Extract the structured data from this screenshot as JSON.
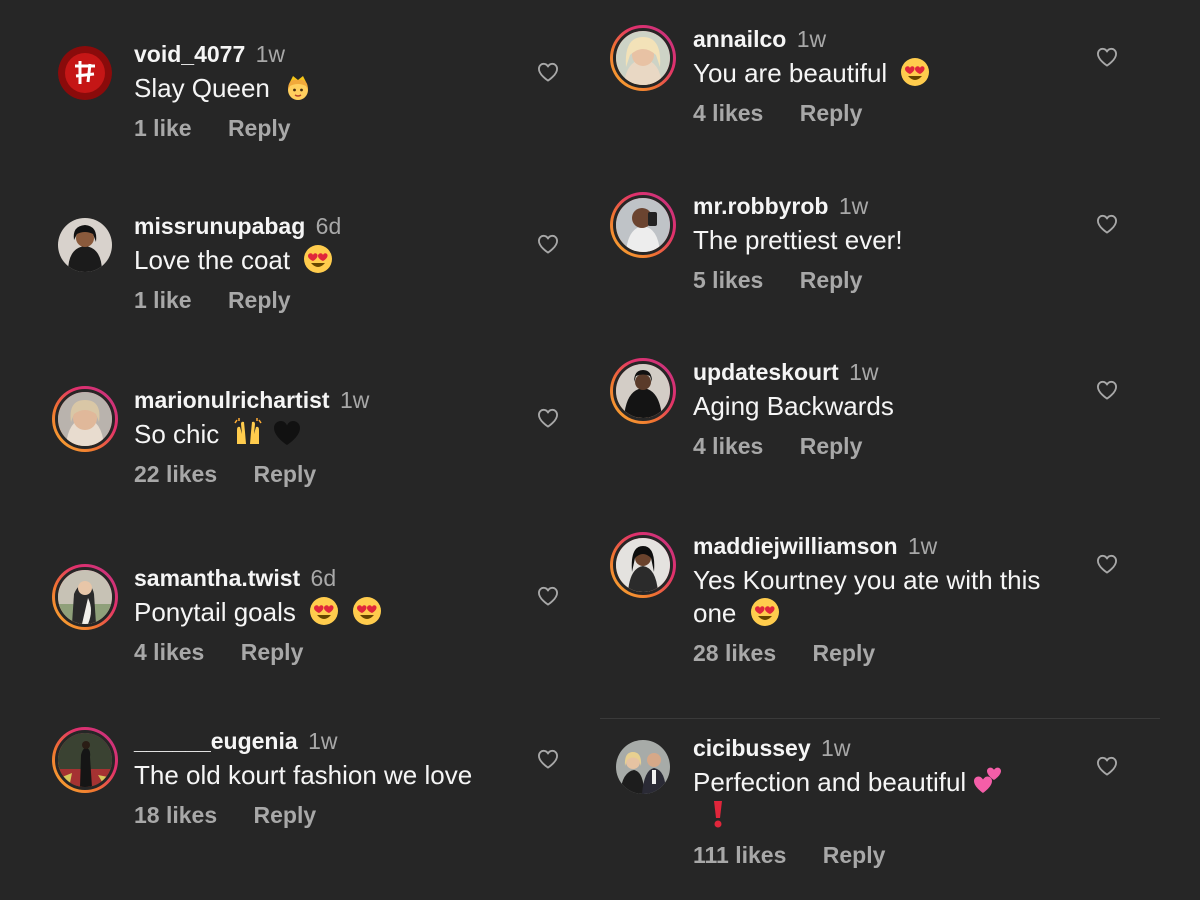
{
  "colors": {
    "background": "#262626",
    "text_primary": "#f5f5f5",
    "text_secondary": "#a8a8a8",
    "story_ring_gradient": [
      "#f9b233",
      "#e1306c",
      "#c13584"
    ]
  },
  "left_comments": [
    {
      "username": "void_4077",
      "time": "1w",
      "text": "Slay Queen",
      "emoji": [
        "princess-emoji"
      ],
      "likes": "1 like",
      "reply": "Reply",
      "story_ring": false
    },
    {
      "username": "missrunupabag",
      "time": "6d",
      "text": "Love the coat",
      "emoji": [
        "heart-eyes-emoji"
      ],
      "likes": "1 like",
      "reply": "Reply",
      "story_ring": false
    },
    {
      "username": "marionulrichartist",
      "time": "1w",
      "text": "So chic",
      "emoji": [
        "raising-hands-emoji",
        "black-heart-emoji"
      ],
      "likes": "22 likes",
      "reply": "Reply",
      "story_ring": true
    },
    {
      "username": "samantha.twist",
      "time": "6d",
      "text": "Ponytail goals",
      "emoji": [
        "heart-eyes-emoji",
        "heart-eyes-emoji"
      ],
      "likes": "4 likes",
      "reply": "Reply",
      "story_ring": true
    },
    {
      "username": "______eugenia",
      "time": "1w",
      "text": "The old kourt fashion we love",
      "emoji": [],
      "likes": "18 likes",
      "reply": "Reply",
      "story_ring": true
    }
  ],
  "right_comments": [
    {
      "username": "annailco",
      "time": "1w",
      "text": "You are beautiful",
      "emoji": [
        "heart-eyes-emoji"
      ],
      "likes": "4 likes",
      "reply": "Reply",
      "story_ring": true
    },
    {
      "username": "mr.robbyrob",
      "time": "1w",
      "text": "The prettiest ever!",
      "emoji": [],
      "likes": "5 likes",
      "reply": "Reply",
      "story_ring": true
    },
    {
      "username": "updateskourt",
      "time": "1w",
      "text": "Aging Backwards",
      "emoji": [],
      "likes": "4 likes",
      "reply": "Reply",
      "story_ring": true
    },
    {
      "username": "maddiejwilliamson",
      "time": "1w",
      "text": "Yes Kourtney you ate with this one",
      "emoji": [
        "heart-eyes-emoji"
      ],
      "likes": "28 likes",
      "reply": "Reply",
      "story_ring": true
    },
    {
      "username": "cicibussey",
      "time": "1w",
      "text": "Perfection and beautiful",
      "emoji": [
        "two-hearts-emoji",
        "red-exclamation-emoji"
      ],
      "likes": "111 likes",
      "reply": "Reply",
      "story_ring": false
    }
  ],
  "icons": {
    "like": "heart-outline-icon"
  }
}
